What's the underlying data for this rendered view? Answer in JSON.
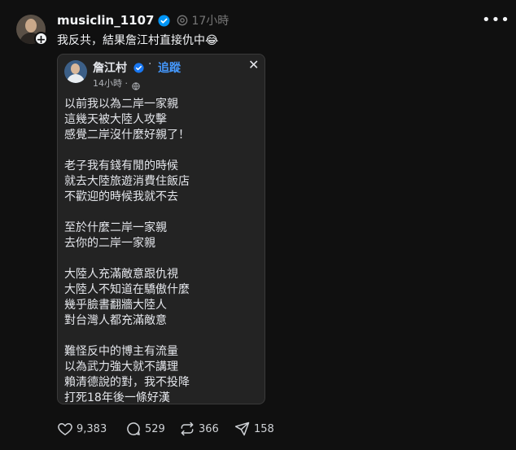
{
  "post": {
    "username": "musiclin_1107",
    "time": "17小時",
    "text": "我反共，結果詹江村直接仇中😂"
  },
  "embedded": {
    "name": "詹江村",
    "dot": "·",
    "follow_label": "追蹤",
    "time": "14小時 ·",
    "body": "以前我以為二岸一家親\n這幾天被大陸人攻擊\n感覺二岸沒什麼好親了！\n\n老子我有錢有閒的時候\n就去大陸旅遊消費住飯店\n不歡迎的時候我就不去\n\n至於什麼二岸一家親\n去你的二岸一家親\n\n大陸人充滿敵意跟仇視\n大陸人不知道在驕傲什麼\n幾乎臉書翻牆大陸人\n對台灣人都充滿敵意\n\n難怪反中的博主有流量\n以為武力強大就不講理\n賴清德說的對，我不投降\n打死18年後一條好漢"
  },
  "actions": {
    "likes": "9,383",
    "comments": "529",
    "reposts": "366",
    "shares": "158"
  },
  "icons": [
    "verified-icon",
    "ai-label-icon",
    "more-icon",
    "globe-icon",
    "close-icon",
    "heart-icon",
    "comment-icon",
    "repost-icon",
    "share-icon"
  ],
  "colors": {
    "background": "#101010",
    "card": "#232323",
    "verified": "#0095f6",
    "follow": "#4599ff"
  }
}
